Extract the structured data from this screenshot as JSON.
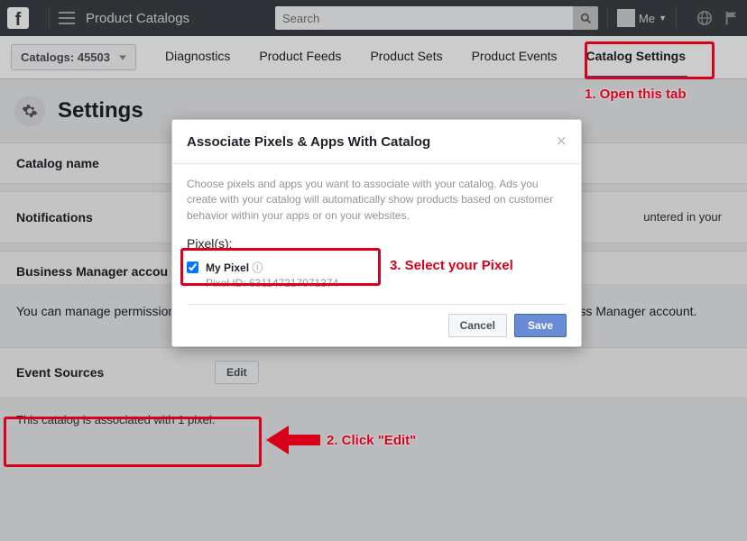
{
  "topbar": {
    "title": "Product Catalogs",
    "search_placeholder": "Search",
    "me_label": "Me"
  },
  "catalog_dropdown": "Catalogs: 45503",
  "tabs": {
    "diagnostics": "Diagnostics",
    "product_feeds": "Product Feeds",
    "product_sets": "Product Sets",
    "product_events": "Product Events",
    "catalog_settings": "Catalog Settings"
  },
  "page": {
    "title": "Settings"
  },
  "sections": {
    "catalog_name_label": "Catalog name",
    "notifications_label": "Notifications",
    "notifications_text": "untered in your",
    "bm_label": "Business Manager accou",
    "bm_info": "You can manage permissions around who can see and edit your catalog by associating it to a Business Manager account.",
    "event_sources_label": "Event Sources",
    "event_sources_edit": "Edit",
    "event_sources_sub": "This catalog is associated with 1 pixel."
  },
  "modal": {
    "title": "Associate Pixels & Apps With Catalog",
    "desc": "Choose pixels and apps you want to associate with your catalog. Ads you create with your catalog will automatically show products based on customer behavior within your apps or on your websites.",
    "pixels_header": "Pixel(s):",
    "pixel_name": "My Pixel",
    "pixel_id": "Pixel ID: 631147217071374",
    "cancel": "Cancel",
    "save": "Save"
  },
  "annotations": {
    "step1": "1. Open this tab",
    "step2": "2. Click \"Edit\"",
    "step3": "3. Select your Pixel"
  }
}
